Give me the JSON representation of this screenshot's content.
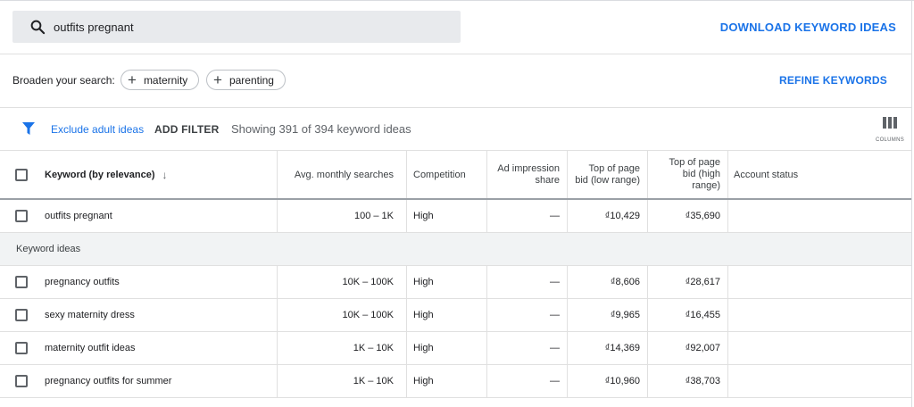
{
  "search": {
    "value": "outfits pregnant",
    "icon": "search-icon"
  },
  "actions": {
    "download_label": "DOWNLOAD KEYWORD IDEAS",
    "refine_label": "REFINE KEYWORDS"
  },
  "broaden": {
    "label": "Broaden your search:",
    "chips": [
      {
        "label": "maternity"
      },
      {
        "label": "parenting"
      }
    ]
  },
  "filters": {
    "exclude_label": "Exclude adult ideas",
    "add_filter_label": "ADD FILTER",
    "showing_text": "Showing 391 of 394 keyword ideas",
    "columns_label": "COLUMNS",
    "accent": "#1a73e8"
  },
  "table": {
    "headers": {
      "keyword": "Keyword (by relevance)",
      "avg": "Avg. monthly searches",
      "competition": "Competition",
      "impression_1": "Ad impression",
      "impression_2": "share",
      "low_1": "Top of page",
      "low_2": "bid (low range)",
      "high_1": "Top of page",
      "high_2": "bid (high",
      "high_3": "range)",
      "status": "Account status"
    },
    "sort_arrow": "↓",
    "provided": [
      {
        "keyword": "outfits pregnant",
        "avg": "100 – 1K",
        "competition": "High",
        "impression": "—",
        "low": "₫10,429",
        "high": "₫35,690",
        "status": ""
      }
    ],
    "section_label": "Keyword ideas",
    "ideas": [
      {
        "keyword": "pregnancy outfits",
        "avg": "10K – 100K",
        "competition": "High",
        "impression": "—",
        "low": "₫8,606",
        "high": "₫28,617",
        "status": ""
      },
      {
        "keyword": "sexy maternity dress",
        "avg": "10K – 100K",
        "competition": "High",
        "impression": "—",
        "low": "₫9,965",
        "high": "₫16,455",
        "status": ""
      },
      {
        "keyword": "maternity outfit ideas",
        "avg": "1K – 10K",
        "competition": "High",
        "impression": "—",
        "low": "₫14,369",
        "high": "₫92,007",
        "status": ""
      },
      {
        "keyword": "pregnancy outfits for summer",
        "avg": "1K – 10K",
        "competition": "High",
        "impression": "—",
        "low": "₫10,960",
        "high": "₫38,703",
        "status": ""
      }
    ]
  }
}
